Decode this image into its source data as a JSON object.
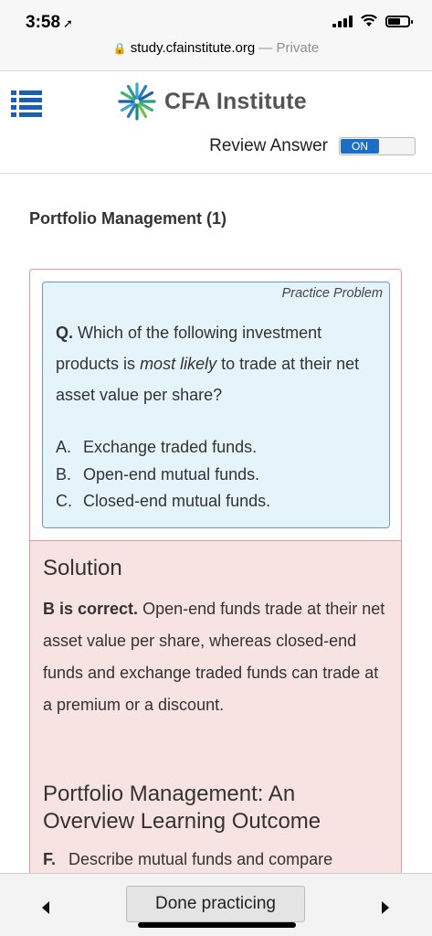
{
  "status_bar": {
    "time": "3:58",
    "location_arrow": "location-arrow-icon",
    "signal_icon": "cellular-signal-icon",
    "wifi_icon": "wifi-icon",
    "battery_icon": "battery-icon"
  },
  "address_bar": {
    "lock_icon": "lock-icon",
    "url": "study.cfainstitute.org",
    "separator": "—",
    "mode": "Private"
  },
  "header": {
    "menu_icon": "hamburger-menu-icon",
    "logo_text": "CFA Institute",
    "review_label": "Review Answer",
    "toggle_state": "ON",
    "accent_color": "#1d6fc4"
  },
  "section_title": "Portfolio Management (1)",
  "question": {
    "tag": "Practice Problem",
    "prefix": "Q.",
    "text_before": "Which of the following investment products is",
    "emphasis": "most likely",
    "text_after": "to trade at their net asset value per share?",
    "options": [
      {
        "letter": "A.",
        "text": "Exchange traded funds."
      },
      {
        "letter": "B.",
        "text": "Open-end mutual funds."
      },
      {
        "letter": "C.",
        "text": "Closed-end mutual funds."
      }
    ]
  },
  "solution": {
    "title": "Solution",
    "verdict": "B is correct.",
    "explanation": "Open-end funds trade at their net asset value per share, whereas closed-end funds and exchange traded funds can trade at a premium or a discount.",
    "learning_outcome_title": "Portfolio Management: An Overview Learning Outcome",
    "learning_outcome_item": {
      "letter": "F.",
      "text": "Describe mutual funds and compare"
    }
  },
  "bottom_bar": {
    "prev_icon": "chevron-left-icon",
    "done_label": "Done practicing",
    "next_icon": "chevron-right-icon"
  },
  "colors": {
    "question_bg": "#e5f3fb",
    "question_border": "#6a9ad6",
    "solution_bg": "#f8e3e3",
    "card_border": "#e09a9a"
  }
}
